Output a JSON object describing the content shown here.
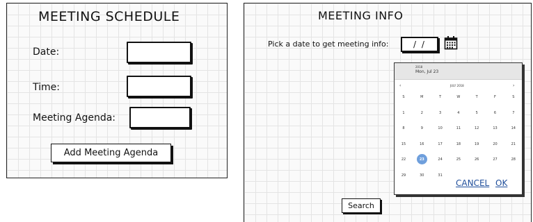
{
  "schedule": {
    "title": "MEETING SCHEDULE",
    "date_label": "Date:",
    "time_label": "Time:",
    "agenda_label": "Meeting Agenda:",
    "add_button": "Add Meeting Agenda"
  },
  "info": {
    "title": "MEETING INFO",
    "pick_label": "Pick a date to get meeting info:",
    "date_value": "/ /",
    "calendar_icon": "calendar-icon",
    "search_button": "Search"
  },
  "calendar": {
    "year": "2018",
    "selected_date": "Mon, Jul 23",
    "month_label": "JULY 2018",
    "prev": "‹",
    "next": "›",
    "weekdays": [
      "S",
      "M",
      "T",
      "W",
      "T",
      "F",
      "S"
    ],
    "weeks": [
      [
        "1",
        "2",
        "3",
        "4",
        "5",
        "6",
        "7"
      ],
      [
        "8",
        "9",
        "10",
        "11",
        "12",
        "13",
        "14"
      ],
      [
        "15",
        "16",
        "17",
        "18",
        "19",
        "20",
        "21"
      ],
      [
        "22",
        "23",
        "24",
        "25",
        "26",
        "27",
        "28"
      ],
      [
        "29",
        "30",
        "31",
        "",
        "",
        "",
        ""
      ]
    ],
    "selected_day": "23",
    "cancel": "CANCEL",
    "ok": "OK"
  },
  "colors": {
    "selection": "#6f9fdc",
    "link": "#1f4e9b",
    "header_bg": "#e6e6e6"
  }
}
